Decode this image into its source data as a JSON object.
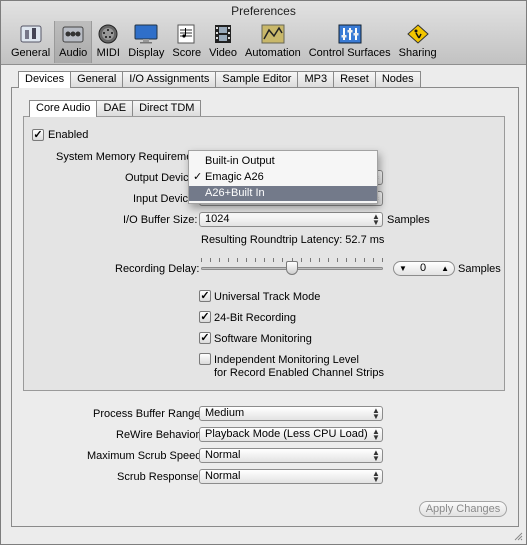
{
  "window": {
    "title": "Preferences"
  },
  "toolbar": {
    "items": [
      {
        "label": "General",
        "icon": "switch-icon"
      },
      {
        "label": "Audio",
        "icon": "audio-interface-icon",
        "selected": true
      },
      {
        "label": "MIDI",
        "icon": "midi-connector-icon"
      },
      {
        "label": "Display",
        "icon": "monitor-icon"
      },
      {
        "label": "Score",
        "icon": "score-notes-icon"
      },
      {
        "label": "Video",
        "icon": "film-icon"
      },
      {
        "label": "Automation",
        "icon": "automation-curve-icon"
      },
      {
        "label": "Control Surfaces",
        "icon": "control-surface-icon"
      },
      {
        "label": "Sharing",
        "icon": "sharing-sign-icon"
      }
    ]
  },
  "top_tabs": [
    "Devices",
    "General",
    "I/O Assignments",
    "Sample Editor",
    "MP3",
    "Reset",
    "Nodes"
  ],
  "sub_tabs": [
    "Core Audio",
    "DAE",
    "Direct TDM"
  ],
  "core_audio": {
    "enabled_label": "Enabled",
    "enabled_checked": true,
    "system_memory_label": "System Memory Requirement",
    "output_device_label": "Output Device",
    "input_device_label": "Input Device",
    "io_buffer_label": "I/O Buffer Size:",
    "io_buffer_value": "1024",
    "samples_label": "Samples",
    "latency_text": "Resulting Roundtrip Latency: 52.7 ms",
    "recording_delay_label": "Recording Delay:",
    "recording_delay_value": "0",
    "recording_delay_slider": 0.5,
    "recording_delay_units": "Samples",
    "universal_track_label": "Universal Track Mode",
    "universal_track_checked": true,
    "bit24_label": "24-Bit Recording",
    "bit24_checked": true,
    "software_monitoring_label": "Software Monitoring",
    "software_monitoring_checked": true,
    "independent_label": "Independent Monitoring Level",
    "independent_sublabel": "for Record Enabled Channel Strips",
    "independent_checked": false
  },
  "device_menu": {
    "items": [
      "Built-in Output",
      "Emagic A26",
      "A26+Built In"
    ],
    "checked": "Emagic A26",
    "highlighted": "A26+Built In"
  },
  "settings": {
    "process_buffer_label": "Process Buffer Range:",
    "process_buffer_value": "Medium",
    "rewire_label": "ReWire Behavior:",
    "rewire_value": "Playback Mode (Less CPU Load)",
    "max_scrub_label": "Maximum Scrub Speed:",
    "max_scrub_value": "Normal",
    "scrub_response_label": "Scrub Response:",
    "scrub_response_value": "Normal"
  },
  "buttons": {
    "apply": "Apply Changes"
  },
  "colors": {
    "menu_highlight": "#737a8a",
    "window_bg": "#ececec"
  }
}
